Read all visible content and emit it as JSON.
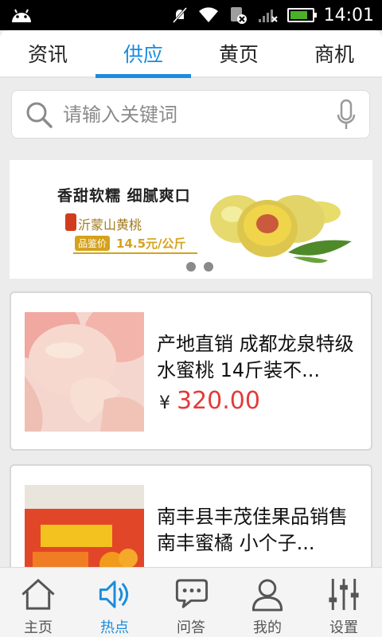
{
  "status_bar": {
    "time": "14:01"
  },
  "tabs": [
    {
      "label": "资讯",
      "active": false
    },
    {
      "label": "供应",
      "active": true
    },
    {
      "label": "黄页",
      "active": false
    },
    {
      "label": "商机",
      "active": false
    }
  ],
  "search": {
    "placeholder": "请输入关键词",
    "value": ""
  },
  "banner": {
    "headline": "香甜软糯 细腻爽口",
    "product": "沂蒙山黄桃",
    "price_label": "品鉴价",
    "price": "14.5元/公斤",
    "slide_count": 2
  },
  "products": [
    {
      "title": "产地直销 成都龙泉特级水蜜桃 14斤装不...",
      "currency": "¥",
      "price": "320.00"
    },
    {
      "title": "南丰县丰茂佳果品销售南丰蜜橘 小个子...",
      "currency": "",
      "price": ""
    }
  ],
  "bottom_nav": [
    {
      "label": "主页",
      "icon": "home-icon",
      "active": false
    },
    {
      "label": "热点",
      "icon": "speaker-icon",
      "active": true
    },
    {
      "label": "问答",
      "icon": "chat-icon",
      "active": false
    },
    {
      "label": "我的",
      "icon": "user-icon",
      "active": false
    },
    {
      "label": "设置",
      "icon": "settings-sliders-icon",
      "active": false
    }
  ],
  "colors": {
    "accent": "#1a8cdc",
    "price": "#e33b3b"
  }
}
